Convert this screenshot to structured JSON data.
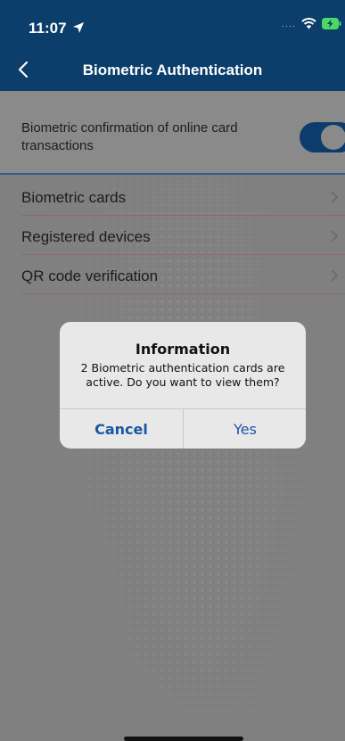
{
  "status_bar": {
    "time": "11:07",
    "signal_dots": "...."
  },
  "nav": {
    "title": "Biometric Authentication"
  },
  "settings": {
    "toggle_label": "Biometric confirmation of online card transactions",
    "toggle_on": true,
    "items": [
      {
        "label": "Biometric cards"
      },
      {
        "label": "Registered devices"
      },
      {
        "label": "QR code verification"
      }
    ]
  },
  "dialog": {
    "title": "Information",
    "message": "2 Biometric authentication cards are active. Do you want to view them?",
    "cancel_label": "Cancel",
    "confirm_label": "Yes"
  },
  "colors": {
    "nav_bg": "#0b3e6a",
    "overlay_bg": "#808080",
    "dialog_button": "#1a56a6",
    "toggle_on": "#0d3c6c"
  },
  "icons": [
    "location-arrow-icon",
    "wifi-icon",
    "battery-charging-icon",
    "back-chevron-icon",
    "chevron-right-icon"
  ]
}
